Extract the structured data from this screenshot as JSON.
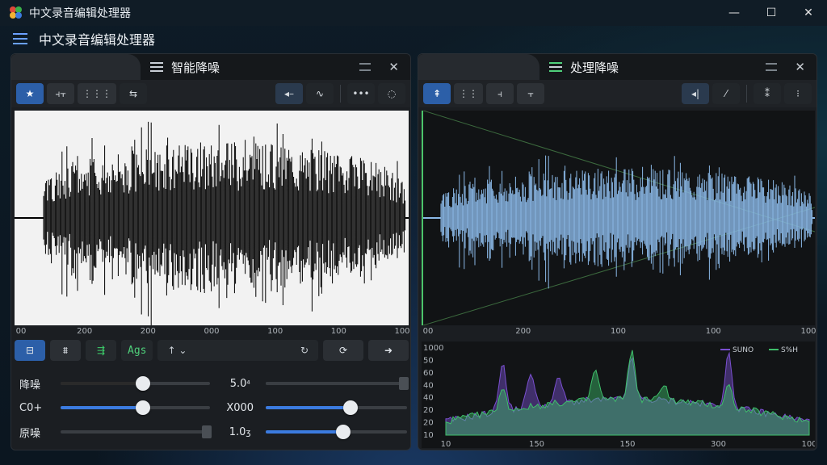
{
  "window": {
    "title": "中文录音编辑处理器",
    "controls": [
      "—",
      "☐",
      "✕"
    ]
  },
  "menubar": {
    "title": "中文录音编辑处理器"
  },
  "left_panel": {
    "title": "智能降噪",
    "toolbar": [
      "★",
      "⫞⫟",
      "⋮⋮⋮",
      "⇆",
      "◂–",
      "∿",
      "•••",
      "◌"
    ],
    "axis_labels": [
      "00",
      "200",
      "200",
      "000",
      "100",
      "100",
      "100"
    ],
    "controls": {
      "b1": "⊟",
      "b2": "⩩",
      "b3": "⇶",
      "label_btn": "Ags",
      "wide_left": "↑  ⌄",
      "wide_right": "↻",
      "refresh": "⟳",
      "play": "➜"
    },
    "sliders": [
      {
        "label": "降噪",
        "value": "5.0",
        "value_suffix": "⁴",
        "level_a": 0.55,
        "level_b": 1.0,
        "fill_a": "#2a2a2a",
        "fill_b": "#3a3e43"
      },
      {
        "label": "C0+",
        "value": "X000",
        "value_suffix": "",
        "level_a": 0.55,
        "level_b": 0.6,
        "fill_a": "#3b7be0",
        "fill_b": "#3b7be0"
      },
      {
        "label": "原噪",
        "value": "1.0",
        "value_suffix": "ʒ",
        "level_a": 0.0,
        "level_b": 0.55,
        "fill_a": "#3a3e43",
        "fill_b": "#3b7be0"
      }
    ]
  },
  "right_panel": {
    "title": "处理降噪",
    "toolbar": [
      "⇞",
      "⋮⋮",
      "⫞",
      "⫟",
      "◂|",
      "⁄",
      "⁑",
      "⁝"
    ],
    "axis_labels": [
      "00",
      "200",
      "100",
      "100",
      "100"
    ],
    "spectrum": {
      "legend": [
        "SUNO",
        "S%H"
      ],
      "y_labels": [
        "1000",
        "50",
        "60",
        "40",
        "40",
        "20",
        "20",
        "10"
      ],
      "x_labels": [
        "10",
        "150",
        "150",
        "300",
        "100"
      ]
    }
  },
  "colors": {
    "accent": "#2c5fa8",
    "waveform_processed": "#8ab8e6",
    "spectrum_purple": "#7a4fd0",
    "spectrum_green": "#3fbf6b"
  }
}
